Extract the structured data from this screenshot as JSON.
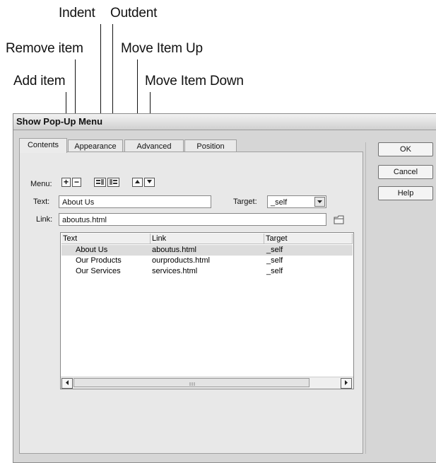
{
  "annotations": {
    "indent": "Indent",
    "outdent": "Outdent",
    "remove_item": "Remove item",
    "move_item_up": "Move Item Up",
    "add_item": "Add item",
    "move_item_down": "Move Item Down"
  },
  "dialog": {
    "title": "Show Pop-Up Menu",
    "close_glyph": "×",
    "tabs": [
      "Contents",
      "Appearance",
      "Advanced",
      "Position"
    ],
    "active_tab": "Contents",
    "buttons": {
      "ok": "OK",
      "cancel": "Cancel",
      "help": "Help"
    },
    "menu_label": "Menu:",
    "text_label": "Text:",
    "text_value": "About Us",
    "target_label": "Target:",
    "target_value": "_self",
    "link_label": "Link:",
    "link_value": "aboutus.html",
    "table": {
      "headers": [
        "Text",
        "Link",
        "Target"
      ],
      "rows": [
        {
          "text": "About Us",
          "link": "aboutus.html",
          "target": "_self"
        },
        {
          "text": "Our Products",
          "link": "ourproducts.html",
          "target": "_self"
        },
        {
          "text": "Our Services",
          "link": "services.html",
          "target": "_self"
        }
      ],
      "selected_row": 0
    },
    "icons": {
      "add": "plus-icon",
      "remove": "minus-icon",
      "indent": "indent-icon",
      "outdent": "outdent-icon",
      "up": "arrow-up-icon",
      "down": "arrow-down-icon",
      "dropdown": "chevron-down-icon",
      "folder": "folder-icon",
      "scroll_left": "arrow-left-icon",
      "scroll_right": "arrow-right-icon"
    }
  }
}
